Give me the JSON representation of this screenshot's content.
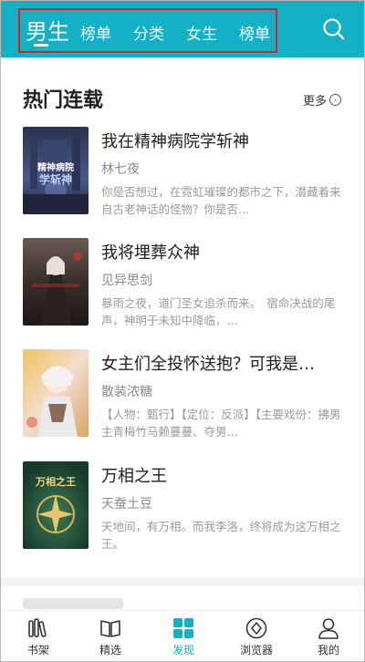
{
  "header": {
    "tabs": [
      {
        "label": "男生",
        "active": true
      },
      {
        "label": "榜单",
        "active": false
      },
      {
        "label": "分类",
        "active": false
      },
      {
        "label": "女生",
        "active": false
      },
      {
        "label": "榜单",
        "active": false
      }
    ],
    "search_icon": "search-icon",
    "accent_color": "#13b0c6"
  },
  "section": {
    "title": "热门连载",
    "more_label": "更多"
  },
  "books": [
    {
      "title": "我在精神病院学斩神",
      "author": "林七夜",
      "desc": "你是否想过，在霓虹璀璨的都市之下，潜藏着来自古老神话的怪物？你是否…",
      "cover_text": "精神病院学斩神"
    },
    {
      "title": "我将埋葬众神",
      "author": "见异思剑",
      "desc": "暴雨之夜，道门圣女追杀而来。　宿命决战的尾声，神明于未知中降临，…"
    },
    {
      "title": "女主们全投怀送抱？可我是…",
      "author": "散装浓糖",
      "desc": "【人物：甄行】【定位：反派】【主要戏份：拂男主青梅竹马赖蔓蔓、夺男…"
    },
    {
      "title": "万相之王",
      "author": "天蚕土豆",
      "desc": "天地间，有万相。而我李洛，终将成为这万相之王。",
      "cover_text": "万相之王"
    }
  ],
  "bottom_nav": [
    {
      "label": "书架",
      "icon": "bookshelf-icon",
      "active": false
    },
    {
      "label": "精选",
      "icon": "open-book-icon",
      "active": false
    },
    {
      "label": "发现",
      "icon": "grid-icon",
      "active": true
    },
    {
      "label": "浏览器",
      "icon": "compass-icon",
      "active": false
    },
    {
      "label": "我的",
      "icon": "user-icon",
      "active": false
    }
  ]
}
